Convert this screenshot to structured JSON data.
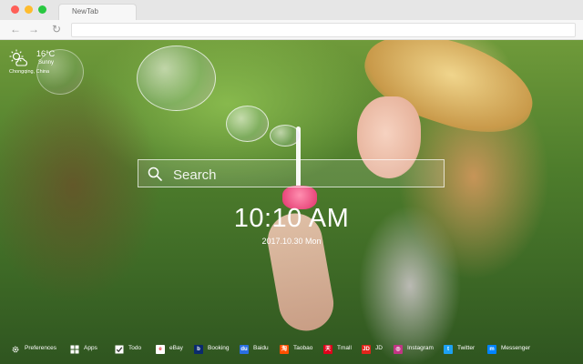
{
  "browser": {
    "tab_title": "NewTab",
    "nav_back": "←",
    "nav_forward": "→",
    "nav_reload": "↻",
    "url": ""
  },
  "weather": {
    "temperature": "16°C",
    "condition": "Sunny",
    "location": "Chongqing, China",
    "icon": "sun-cloud-icon"
  },
  "search": {
    "placeholder": "Search",
    "value": ""
  },
  "clock": {
    "time": "10:10 AM",
    "date": "2017.10.30 Mon"
  },
  "bottom_bar": {
    "preferences_label": "Preferences",
    "apps_label": "Apps",
    "todo_label": "Todo",
    "bookmarks": [
      {
        "label": "eBay",
        "icon": "ebay-icon",
        "color": "#ffffff",
        "glyph": "e"
      },
      {
        "label": "Booking",
        "icon": "booking-icon",
        "color": "#0a2a6e",
        "glyph": "b"
      },
      {
        "label": "Baidu",
        "icon": "baidu-icon",
        "color": "#2a6fe0",
        "glyph": "du"
      },
      {
        "label": "Taobao",
        "icon": "taobao-icon",
        "color": "#ff5000",
        "glyph": "淘"
      },
      {
        "label": "Tmall",
        "icon": "tmall-icon",
        "color": "#e0001b",
        "glyph": "天"
      },
      {
        "label": "JD",
        "icon": "jd-icon",
        "color": "#e1251b",
        "glyph": "JD"
      },
      {
        "label": "Instagram",
        "icon": "instagram-icon",
        "color": "#c13584",
        "glyph": "◎"
      },
      {
        "label": "Twitter",
        "icon": "twitter-icon",
        "color": "#1da1f2",
        "glyph": "t"
      },
      {
        "label": "Messenger",
        "icon": "messenger-icon",
        "color": "#0084ff",
        "glyph": "m"
      }
    ]
  }
}
